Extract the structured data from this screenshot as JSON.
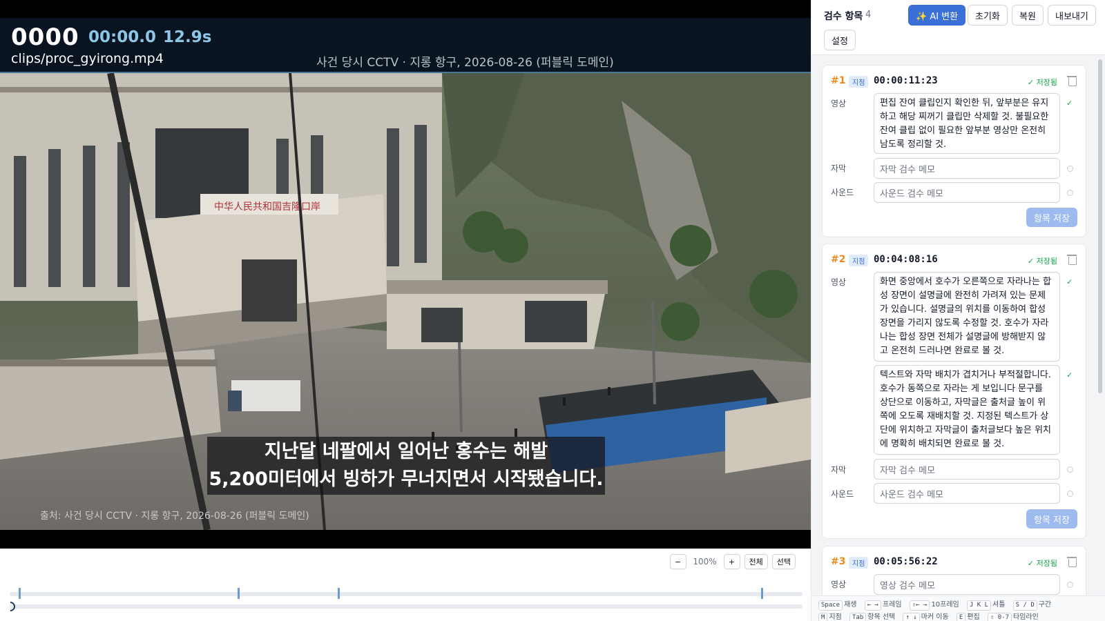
{
  "video": {
    "frame": "0000",
    "time": "00:00.0",
    "duration": "12.9s",
    "file": "clips/proc_gyirong.mp4",
    "caption": "사건 당시 CCTV · 지롱 항구, 2026-08-26 (퍼블릭 도메인)",
    "subtitle_line1": "지난달 네팔에서 일어난 홍수는 해발",
    "subtitle_line2": "5,200미터에서 빙하가 무너지면서 시작됐습니다.",
    "source_text": "출처: 사건 당시 CCTV · 지롱 항구, 2026-08-26 (퍼블릭 도메인)",
    "sign_text": "中华人民共和国吉隆口岸"
  },
  "timeline": {
    "zoom_out": "−",
    "zoom_level": "100%",
    "zoom_in": "+",
    "all_label": "전체",
    "select_label": "선택"
  },
  "panel": {
    "title": "검수 항목",
    "count": "4",
    "ai_button": "✨ AI 변환",
    "reset_button": "초기화",
    "restore_button": "복원",
    "export_button": "내보내기",
    "settings_button": "설정"
  },
  "labels": {
    "video": "영상",
    "subtitle": "자막",
    "sound": "사운드",
    "badge": "지점",
    "saved": "✓ 저장됨",
    "save_item": "항목 저장",
    "subtitle_placeholder": "자막 검수 메모",
    "sound_placeholder": "사운드 검수 메모",
    "video_placeholder": "영상 검수 메모",
    "check": "✓"
  },
  "items": [
    {
      "num": "#1",
      "timecode": "00:00:11:23",
      "video_note": "편집 잔여 클립인지 확인한 뒤, 앞부분은 유지하고 해당 찌꺼기 클립만 삭제할 것. 불필요한 잔여 클립 없이 필요한 앞부분 영상만 온전히 남도록 정리할 것."
    },
    {
      "num": "#2",
      "timecode": "00:04:08:16",
      "video_note": "화면 중앙에서 호수가 오른쪽으로 자라나는 합성 장면이 설명글에 완전히 가려져 있는 문제가 있습니다. 설명글의 위치를 이동하여 합성 장면을 가리지 않도록 수정할 것. 호수가 자라나는 합성 장면 전체가 설명글에 방해받지 않고 온전히 드러나면 완료로 볼 것.",
      "video_note_2": "텍스트와 자막 배치가 겹치거나 부적절합니다. 호수가 동쪽으로 자라는 게 보입니다 문구를 상단으로 이동하고, 자막글은 출처글 높이 위쪽에 오도록 재배치할 것. 지정된 텍스트가 상단에 위치하고 자막글이 출처글보다 높은 위치에 명확히 배치되면 완료로 볼 것."
    },
    {
      "num": "#3",
      "timecode": "00:05:56:22"
    }
  ],
  "shortcuts": [
    {
      "key": "Space",
      "label": "재생"
    },
    {
      "key": "← →",
      "label": "프레임"
    },
    {
      "key": "⇧← →",
      "label": "10프레임"
    },
    {
      "key": "J K L",
      "label": "셔틀"
    },
    {
      "key": "S / D",
      "label": "구간"
    },
    {
      "key": "M",
      "label": "지점"
    },
    {
      "key": "Tab",
      "label": "항목 선택"
    },
    {
      "key": "↑ ↓",
      "label": "마커 이동"
    },
    {
      "key": "E",
      "label": "편집"
    },
    {
      "key": "⇧ 0-7",
      "label": "타임라인"
    }
  ]
}
